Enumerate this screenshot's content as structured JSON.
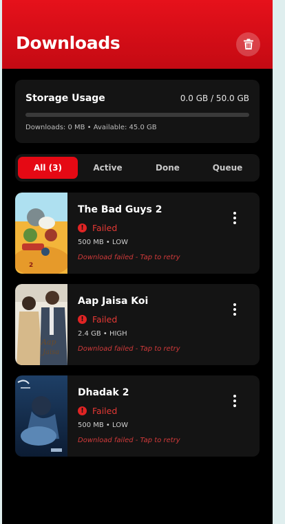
{
  "header": {
    "title": "Downloads",
    "trash_icon": "trash-icon"
  },
  "storage": {
    "title": "Storage Usage",
    "value": "0.0 GB / 50.0 GB",
    "used_fraction": 0,
    "meta": "Downloads: 0 MB • Available: 45.0 GB"
  },
  "tabs": [
    "All (3)",
    "Active",
    "Done",
    "Queue"
  ],
  "active_tab": "All (3)",
  "colors": {
    "accent": "#e50914",
    "failed": "#e53935"
  },
  "downloads": [
    {
      "title": "The Bad Guys 2",
      "status": "Failed",
      "meta": "500 MB • LOW",
      "error": "Download failed - Tap to retry"
    },
    {
      "title": "Aap Jaisa Koi",
      "status": "Failed",
      "meta": "2.4 GB • HIGH",
      "error": "Download failed - Tap to retry"
    },
    {
      "title": "Dhadak 2",
      "status": "Failed",
      "meta": "500 MB • LOW",
      "error": "Download failed - Tap to retry"
    }
  ]
}
